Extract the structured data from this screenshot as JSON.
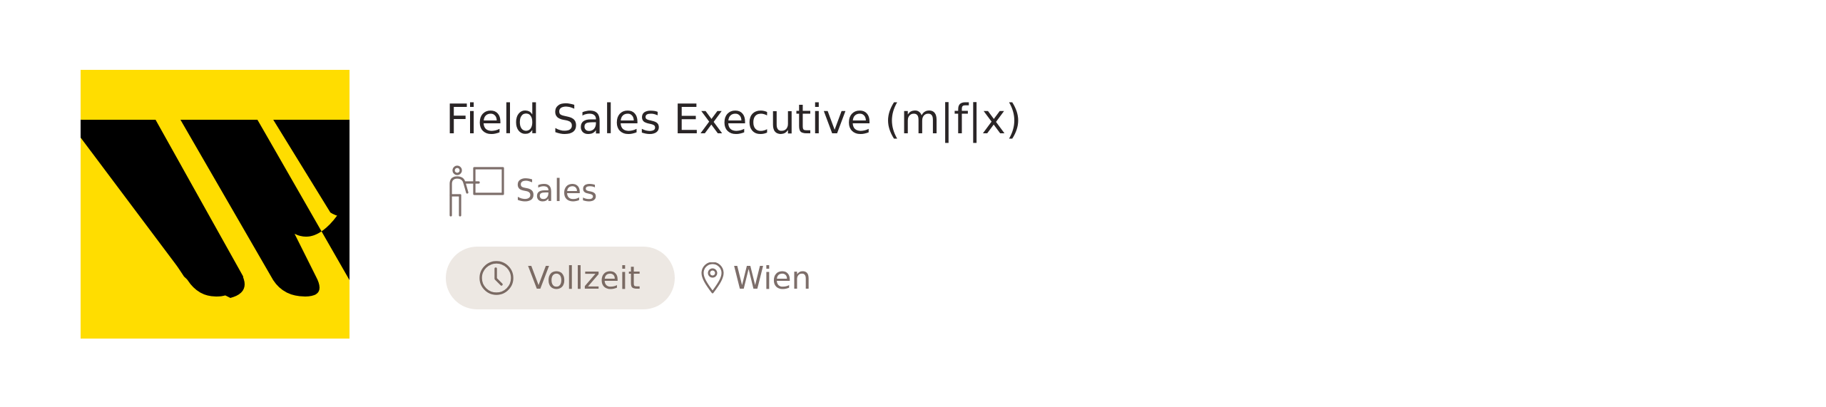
{
  "job": {
    "title": "Field Sales Executive (m|f|x)",
    "category": {
      "label": "Sales",
      "icon": "presenter-icon"
    },
    "employment_type": {
      "label": "Vollzeit",
      "icon": "clock-icon"
    },
    "location": {
      "label": "Wien",
      "icon": "map-pin-icon"
    }
  },
  "company": {
    "logo_icon": "company-logo"
  },
  "colors": {
    "logo_background": "#ffdd00",
    "logo_mark": "#000000",
    "title_text": "#2a2526",
    "secondary_text": "#7d6e6a",
    "tag_background": "#ede8e3"
  }
}
